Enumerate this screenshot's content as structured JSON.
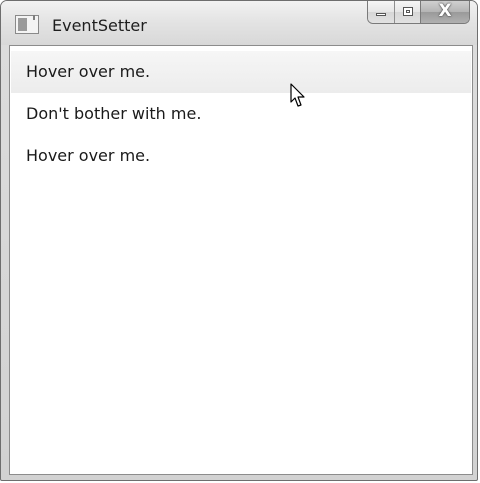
{
  "window": {
    "title": "EventSetter"
  },
  "caption_buttons": {
    "minimize_icon": "minimize-icon",
    "maximize_icon": "restore-icon",
    "close_glyph": "X"
  },
  "content": {
    "items": [
      {
        "label": "Hover over me.",
        "state": "hovered"
      },
      {
        "label": "Don't bother with me.",
        "state": "normal"
      },
      {
        "label": "Hover over me.",
        "state": "normal"
      }
    ]
  },
  "colors": {
    "background": "#ffffff",
    "frame": "#d2d2d2",
    "text": "#1a1a1a",
    "hover_background": "#f0f0f0"
  }
}
